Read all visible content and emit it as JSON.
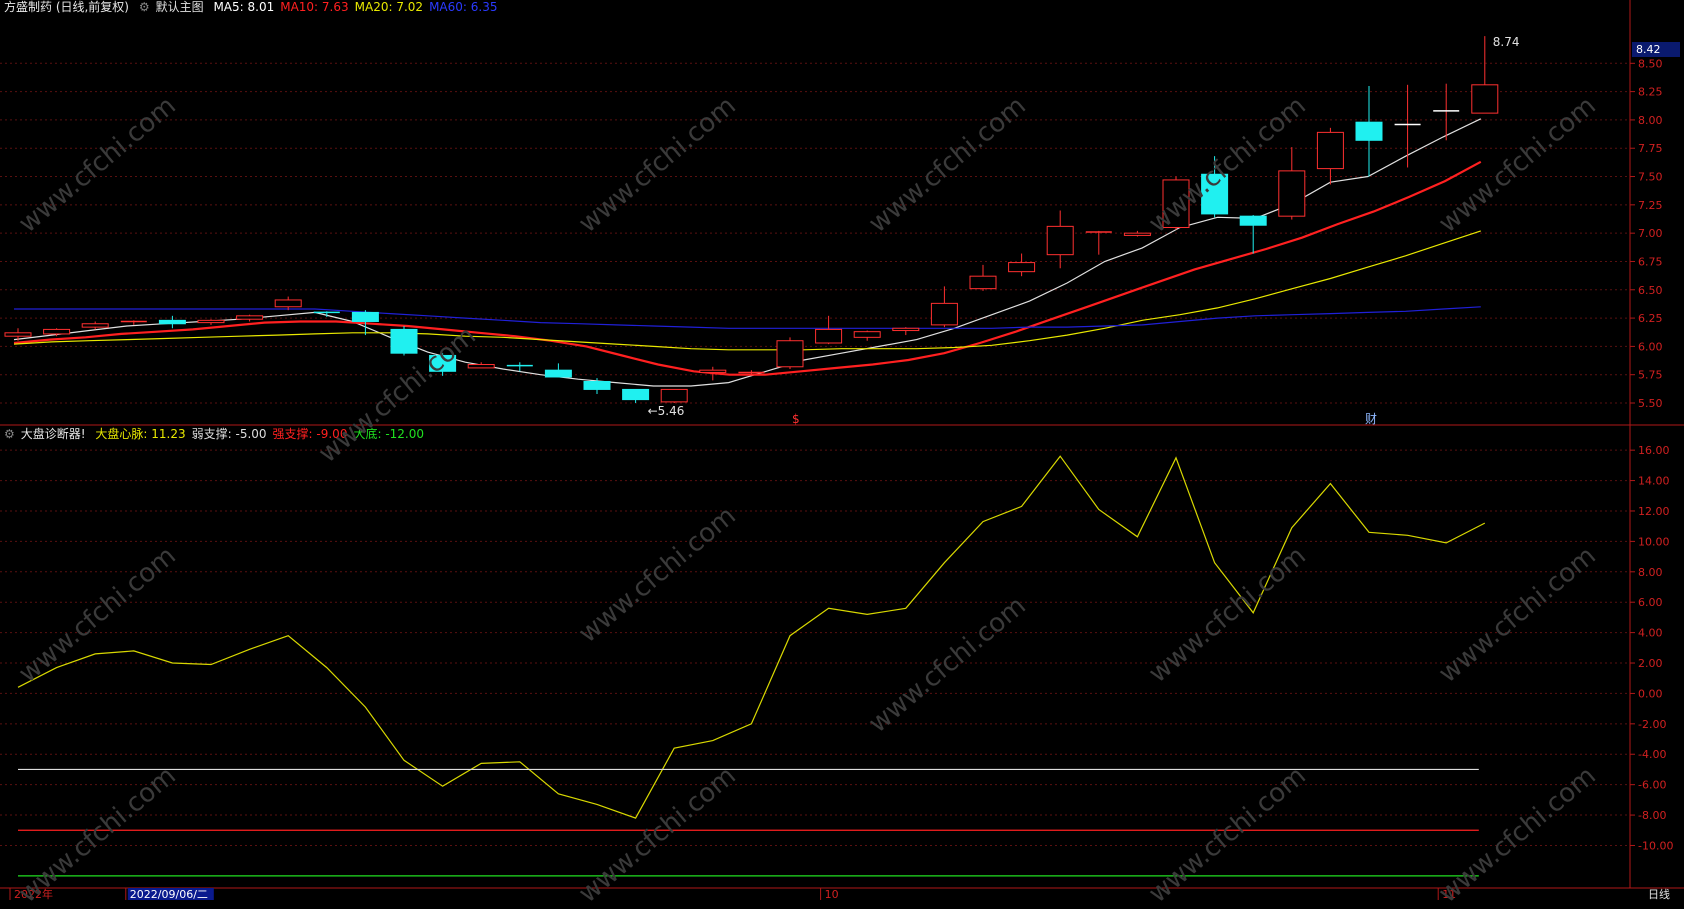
{
  "header": {
    "title": "方盛制药 (日线,前复权)",
    "main_indicator": "默认主图",
    "ma": [
      {
        "label": "MA5:",
        "value": "8.01",
        "color": "#ffffff"
      },
      {
        "label": "MA10:",
        "value": "7.63",
        "color": "#ff2020"
      },
      {
        "label": "MA20:",
        "value": "7.02",
        "color": "#e8e800"
      },
      {
        "label": "MA60:",
        "value": "6.35",
        "color": "#2a3aff"
      }
    ]
  },
  "sub_header": {
    "title": "大盘诊断器!",
    "items": [
      {
        "label": "大盘心脉:",
        "value": "11.23",
        "color": "#e8e800"
      },
      {
        "label": "弱支撑:",
        "value": "-5.00",
        "color": "#dddddd"
      },
      {
        "label": "强支撑:",
        "value": "-9.00",
        "color": "#ff2020"
      },
      {
        "label": "大底:",
        "value": "-12.00",
        "color": "#20e020"
      }
    ]
  },
  "current_price": "8.42",
  "annotations": {
    "high": "8.74",
    "low": "5.46",
    "marker1": "$",
    "marker2": "财"
  },
  "time_axis": {
    "labels": [
      {
        "text": "2022年",
        "i": 0
      },
      {
        "text": "2022/09/06/二",
        "i": 3,
        "highlight": true
      },
      {
        "text": "10",
        "i": 21
      },
      {
        "text": "11",
        "i": 37
      }
    ],
    "period": "日线"
  },
  "watermark": "www.cfchi.com",
  "chart_data": [
    {
      "type": "candlestick",
      "title": "方盛制药 (日线,前复权)",
      "ylim": [
        5.35,
        8.9
      ],
      "yticks": [
        "5.50",
        "5.75",
        "6.00",
        "6.25",
        "6.50",
        "6.75",
        "7.00",
        "7.25",
        "7.50",
        "7.75",
        "8.00",
        "8.25",
        "8.50"
      ],
      "candles": [
        [
          6.09,
          6.12,
          6.05,
          6.16
        ],
        [
          6.11,
          6.15,
          6.09,
          6.16
        ],
        [
          6.17,
          6.2,
          6.15,
          6.22
        ],
        [
          6.21,
          6.22,
          6.19,
          6.23
        ],
        [
          6.23,
          6.2,
          6.16,
          6.27
        ],
        [
          6.21,
          6.23,
          6.19,
          6.24
        ],
        [
          6.24,
          6.27,
          6.22,
          6.28
        ],
        [
          6.35,
          6.41,
          6.32,
          6.44
        ],
        [
          6.3,
          6.29,
          6.26,
          6.31
        ],
        [
          6.3,
          6.22,
          6.1,
          6.32
        ],
        [
          6.15,
          5.94,
          5.92,
          6.18
        ],
        [
          5.92,
          5.78,
          5.74,
          5.94
        ],
        [
          5.81,
          5.84,
          5.81,
          5.86
        ],
        [
          5.83,
          5.82,
          5.78,
          5.86
        ],
        [
          5.79,
          5.73,
          5.73,
          5.85
        ],
        [
          5.69,
          5.62,
          5.58,
          5.72
        ],
        [
          5.62,
          5.53,
          5.5,
          5.62
        ],
        [
          5.51,
          5.62,
          5.5,
          5.62
        ],
        [
          5.77,
          5.79,
          5.7,
          5.82
        ],
        [
          5.77,
          5.77,
          5.75,
          5.79
        ],
        [
          5.82,
          6.05,
          5.8,
          6.08
        ],
        [
          6.03,
          6.15,
          6.02,
          6.27
        ],
        [
          6.08,
          6.13,
          6.05,
          6.14
        ],
        [
          6.14,
          6.16,
          6.1,
          6.17
        ],
        [
          6.19,
          6.38,
          6.17,
          6.53
        ],
        [
          6.51,
          6.62,
          6.49,
          6.72
        ],
        [
          6.66,
          6.74,
          6.62,
          6.82
        ],
        [
          6.81,
          7.06,
          6.69,
          7.2
        ],
        [
          7.0,
          7.01,
          6.81,
          7.02
        ],
        [
          6.98,
          7.0,
          6.97,
          7.02
        ],
        [
          7.05,
          7.47,
          7.03,
          7.5
        ],
        [
          7.52,
          7.17,
          7.14,
          7.68
        ],
        [
          7.15,
          7.07,
          6.82,
          7.16
        ],
        [
          7.15,
          7.55,
          7.12,
          7.76
        ],
        [
          7.57,
          7.89,
          7.43,
          7.93
        ],
        [
          7.98,
          7.82,
          7.5,
          8.3
        ],
        [
          7.96,
          7.96,
          7.58,
          8.31
        ],
        [
          8.08,
          8.08,
          7.82,
          8.32
        ],
        [
          8.06,
          8.31,
          8.06,
          8.74
        ]
      ],
      "series": [
        {
          "name": "MA5",
          "color": "#e0e0e0",
          "values": [
            6.06,
            6.1,
            6.14,
            6.18,
            6.2,
            6.22,
            6.24,
            6.27,
            6.3,
            6.22,
            6.08,
            5.95,
            5.86,
            5.8,
            5.75,
            5.71,
            5.68,
            5.65,
            5.65,
            5.68,
            5.78,
            5.88,
            5.94,
            6.0,
            6.06,
            6.16,
            6.28,
            6.4,
            6.56,
            6.75,
            6.87,
            7.05,
            7.14,
            7.13,
            7.26,
            7.45,
            7.5,
            7.68,
            7.85,
            8.01
          ]
        },
        {
          "name": "MA10",
          "color": "#ff2020",
          "values": [
            6.03,
            6.06,
            6.08,
            6.11,
            6.13,
            6.15,
            6.18,
            6.21,
            6.22,
            6.22,
            6.2,
            6.18,
            6.15,
            6.12,
            6.09,
            6.05,
            6.0,
            5.92,
            5.84,
            5.78,
            5.75,
            5.75,
            5.78,
            5.81,
            5.84,
            5.88,
            5.94,
            6.03,
            6.13,
            6.24,
            6.35,
            6.46,
            6.57,
            6.68,
            6.77,
            6.86,
            6.96,
            7.08,
            7.19,
            7.32,
            7.46,
            7.63
          ]
        },
        {
          "name": "MA20",
          "color": "#e8e800",
          "values": [
            6.02,
            6.04,
            6.05,
            6.06,
            6.07,
            6.08,
            6.09,
            6.1,
            6.11,
            6.12,
            6.12,
            6.11,
            6.09,
            6.08,
            6.06,
            6.04,
            6.02,
            6.0,
            5.98,
            5.97,
            5.97,
            5.97,
            5.98,
            5.98,
            5.98,
            5.99,
            6.01,
            6.05,
            6.1,
            6.16,
            6.23,
            6.28,
            6.34,
            6.42,
            6.51,
            6.6,
            6.7,
            6.8,
            6.91,
            7.02
          ]
        },
        {
          "name": "MA60",
          "color": "#2020d8",
          "values": [
            6.33,
            6.33,
            6.33,
            6.33,
            6.33,
            6.33,
            6.33,
            6.33,
            6.33,
            6.31,
            6.29,
            6.27,
            6.25,
            6.23,
            6.21,
            6.2,
            6.19,
            6.18,
            6.17,
            6.16,
            6.16,
            6.16,
            6.16,
            6.16,
            6.16,
            6.16,
            6.16,
            6.17,
            6.17,
            6.18,
            6.19,
            6.22,
            6.25,
            6.27,
            6.28,
            6.29,
            6.3,
            6.31,
            6.33,
            6.35
          ]
        }
      ]
    },
    {
      "type": "line",
      "title": "大盘诊断器!",
      "ylim": [
        -12.6,
        16.8
      ],
      "yticks": [
        "16.00",
        "14.00",
        "12.00",
        "10.00",
        "8.00",
        "6.00",
        "4.00",
        "2.00",
        "0.00",
        "-2.00",
        "-4.00",
        "-6.00",
        "-8.00",
        "-10.00"
      ],
      "series": [
        {
          "name": "大盘心脉",
          "color": "#d8d800",
          "values": [
            0.4,
            1.7,
            2.6,
            2.8,
            2.0,
            1.9,
            2.9,
            3.8,
            1.7,
            -0.9,
            -4.4,
            -6.1,
            -4.6,
            -4.5,
            -6.6,
            -7.3,
            -8.2,
            -3.6,
            -3.1,
            -2.0,
            3.8,
            5.6,
            5.2,
            5.6,
            8.6,
            11.3,
            12.3,
            15.6,
            12.1,
            10.3,
            15.5,
            8.6,
            5.3,
            10.9,
            13.8,
            10.6,
            10.4,
            9.9,
            11.2
          ]
        },
        {
          "name": "弱支撑",
          "color": "#dddddd",
          "values": [
            -5.0
          ]
        },
        {
          "name": "强支撑",
          "color": "#ff2020",
          "values": [
            -9.0
          ]
        },
        {
          "name": "大底",
          "color": "#20e020",
          "values": [
            -12.0
          ]
        }
      ]
    }
  ]
}
